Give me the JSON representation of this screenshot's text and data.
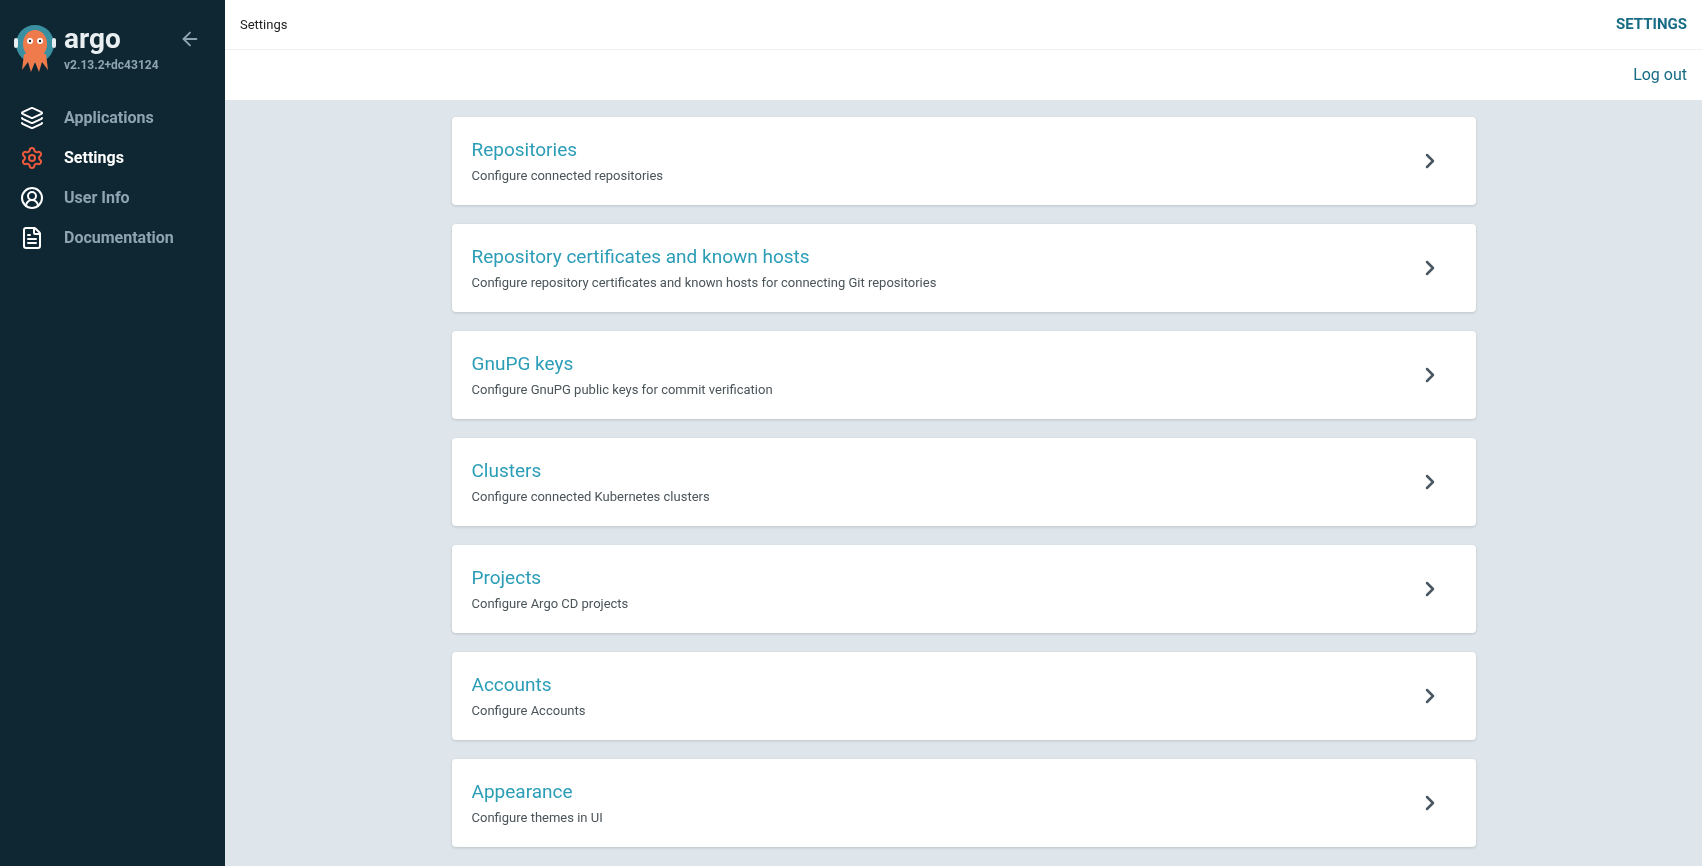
{
  "sidebar": {
    "brand": "argo",
    "version": "v2.13.2+dc43124",
    "items": [
      {
        "label": "Applications",
        "selected": false
      },
      {
        "label": "Settings",
        "selected": true
      },
      {
        "label": "User Info",
        "selected": false
      },
      {
        "label": "Documentation",
        "selected": false
      }
    ]
  },
  "header": {
    "breadcrumb": "Settings",
    "title": "SETTINGS",
    "action": "Log out"
  },
  "cards": [
    {
      "title": "Repositories",
      "description": "Configure connected repositories"
    },
    {
      "title": "Repository certificates and known hosts",
      "description": "Configure repository certificates and known hosts for connecting Git repositories"
    },
    {
      "title": "GnuPG keys",
      "description": "Configure GnuPG public keys for commit verification"
    },
    {
      "title": "Clusters",
      "description": "Configure connected Kubernetes clusters"
    },
    {
      "title": "Projects",
      "description": "Configure Argo CD projects"
    },
    {
      "title": "Accounts",
      "description": "Configure Accounts"
    },
    {
      "title": "Appearance",
      "description": "Configure themes in UI"
    }
  ]
}
